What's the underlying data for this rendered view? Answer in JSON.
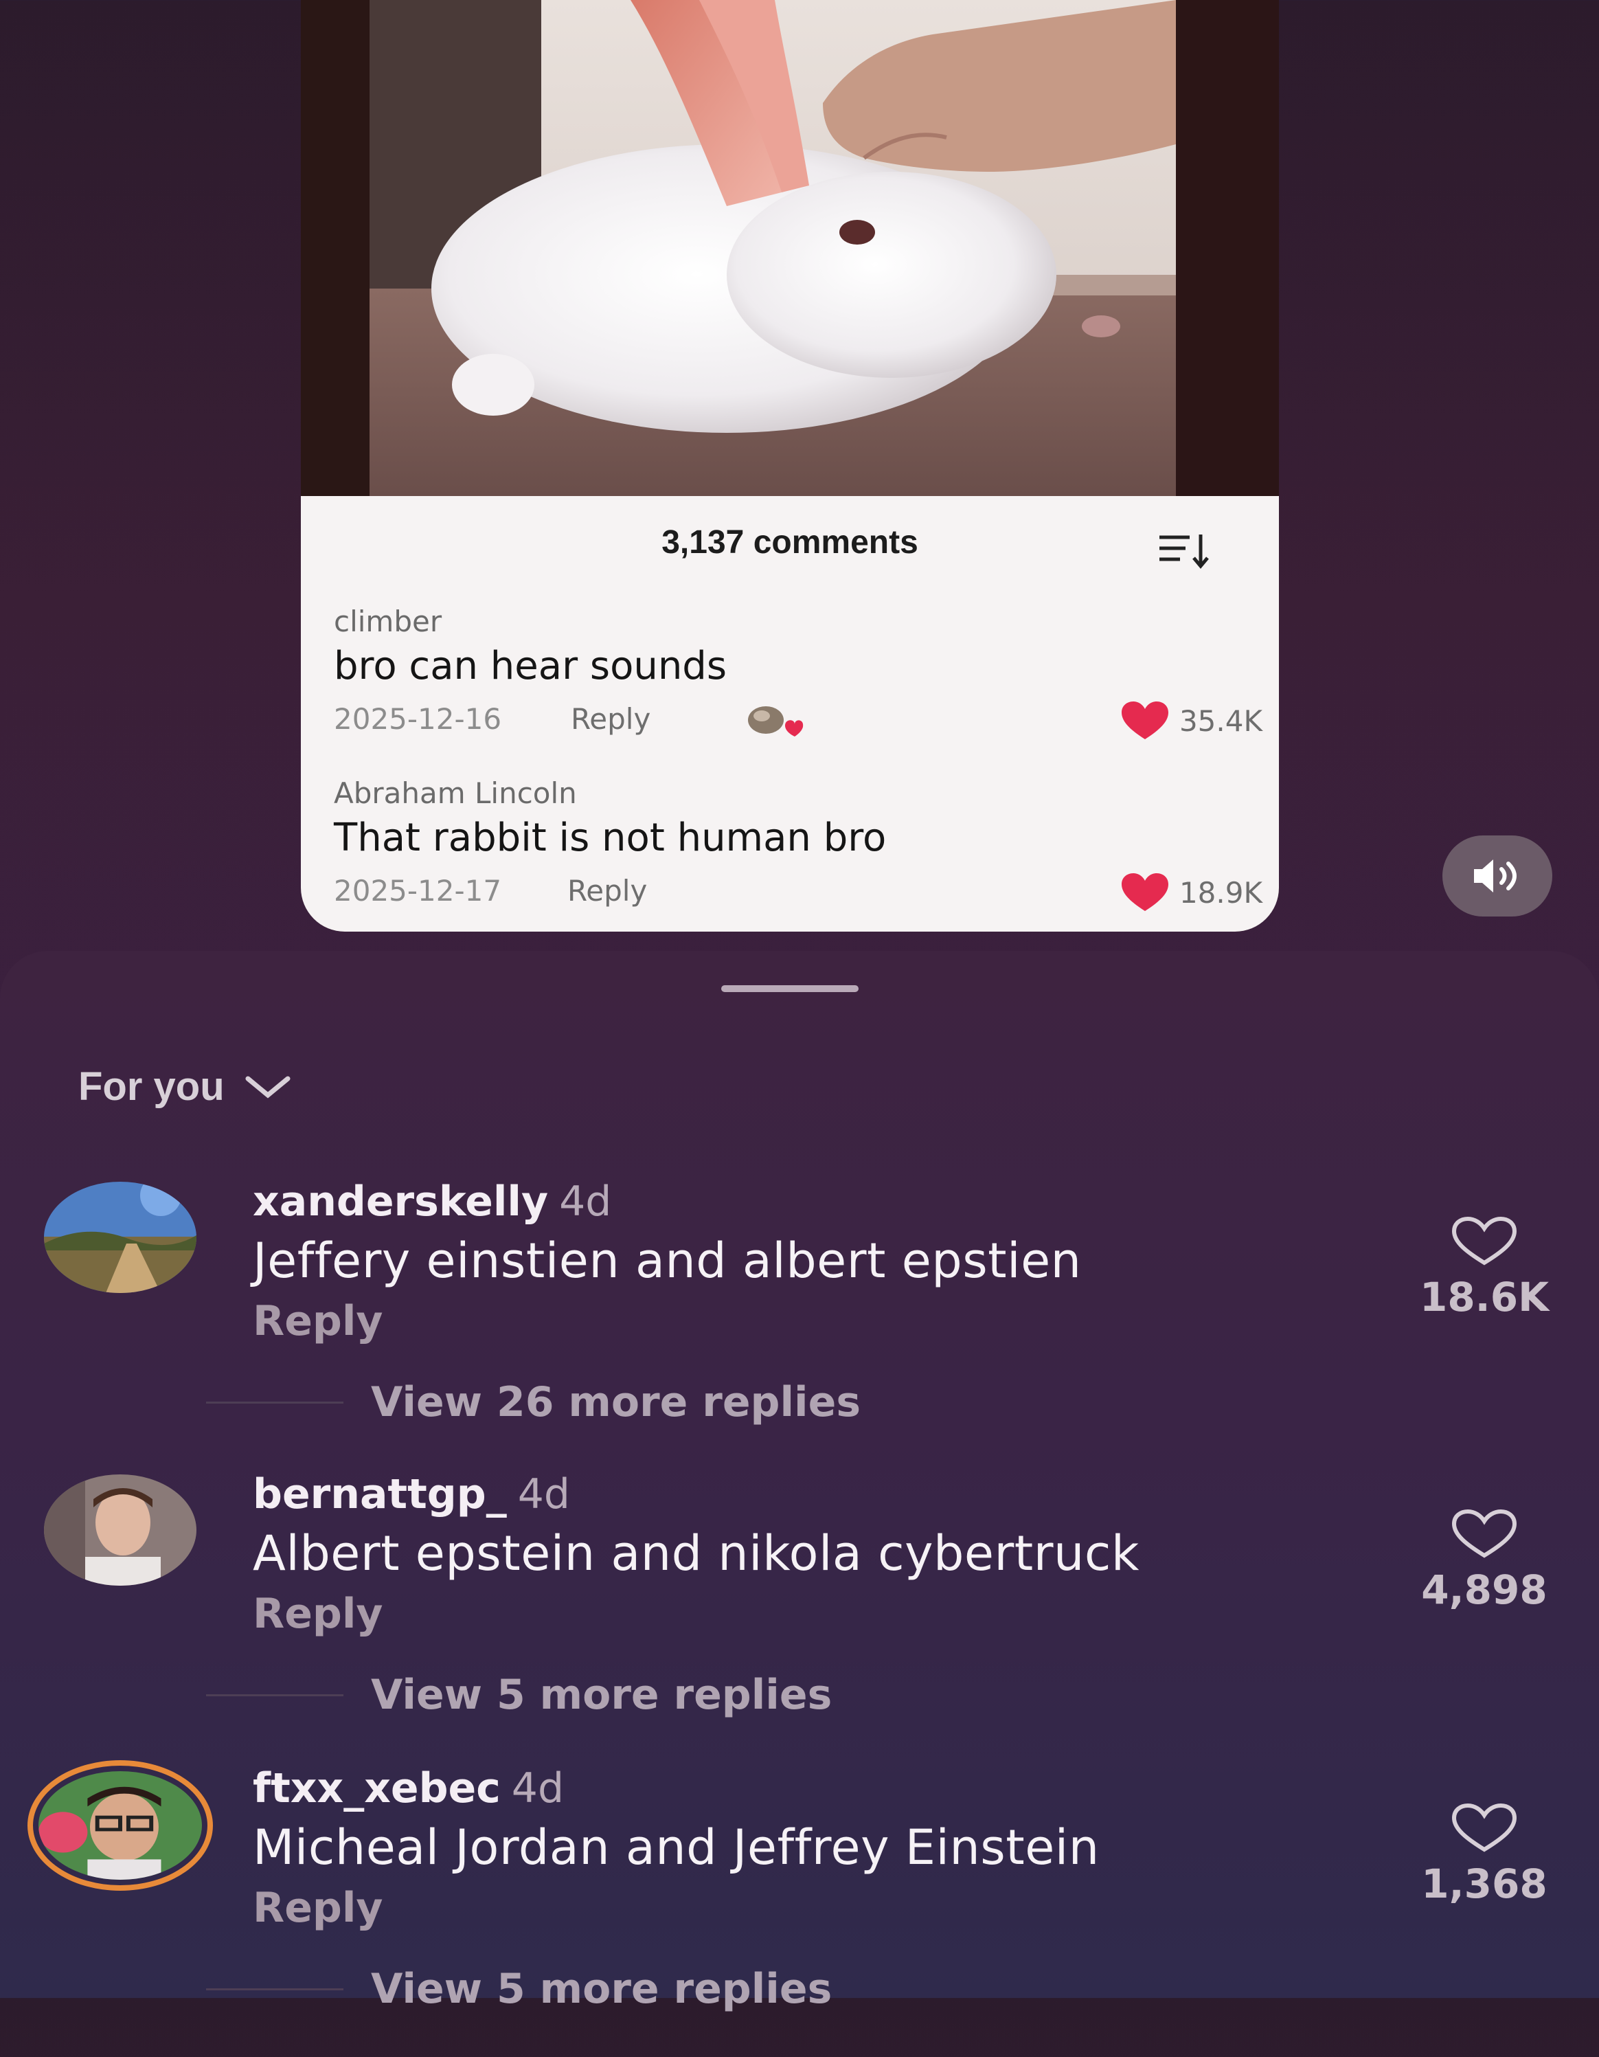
{
  "video": {
    "comments_title": "3,137 comments",
    "comments": [
      {
        "user": "climber",
        "text": "bro can hear sounds",
        "date": "2025-12-16",
        "reply": "Reply",
        "likes": "35.4K",
        "has_sticker": true
      },
      {
        "user": "Abraham Lincoln",
        "text": "That rabbit is not human bro",
        "date": "2025-12-17",
        "reply": "Reply",
        "likes": "18.9K",
        "has_sticker": false
      }
    ]
  },
  "sound_icon": "speaker-on-icon",
  "sheet": {
    "filter_label": "For you",
    "comments": [
      {
        "user": "xanderskelly",
        "time": "4d",
        "text": "Jeffery einstien and albert epstien",
        "reply": "Reply",
        "likes": "18.6K",
        "more": "View 26 more replies"
      },
      {
        "user": "bernattgp_",
        "time": "4d",
        "text": "Albert epstein and nikola cybertruck",
        "reply": "Reply",
        "likes": "4,898",
        "more": "View 5 more replies"
      },
      {
        "user": "ftxx_xebec",
        "time": "4d",
        "text": "Micheal Jordan and Jeffrey Einstein",
        "reply": "Reply",
        "likes": "1,368",
        "more": "View 5 more replies"
      }
    ]
  },
  "colors": {
    "like_red": "#e52a4f",
    "sheet_bg": "#3a2446",
    "avatar_ring": "#e88a39"
  }
}
